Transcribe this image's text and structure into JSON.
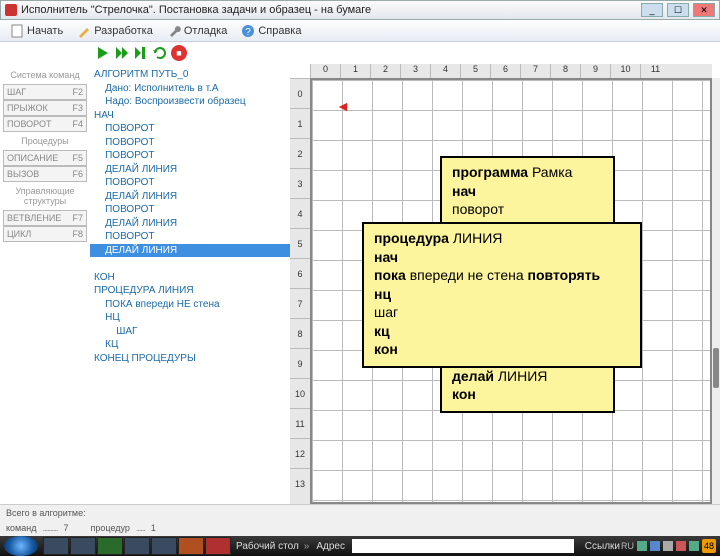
{
  "window": {
    "title": "Исполнитель \"Стрелочка\". Постановка задачи и образец - на бумаге"
  },
  "menu": {
    "start": "Начать",
    "dev": "Разработка",
    "debug": "Отладка",
    "help": "Справка"
  },
  "sidebar": {
    "hdr1": "Система команд",
    "items1": [
      {
        "label": "ШАГ",
        "key": "F2"
      },
      {
        "label": "ПРЫЖОК",
        "key": "F3"
      },
      {
        "label": "ПОВОРОТ",
        "key": "F4"
      }
    ],
    "hdr2": "Процедуры",
    "items2": [
      {
        "label": "ОПИСАНИЕ",
        "key": "F5"
      },
      {
        "label": "ВЫЗОВ",
        "key": "F6"
      }
    ],
    "hdr3": "Управляющие структуры",
    "items3": [
      {
        "label": "ВЕТВЛЕНИЕ",
        "key": "F7"
      },
      {
        "label": "ЦИКЛ",
        "key": "F8"
      }
    ]
  },
  "code": {
    "lines": [
      "АЛГОРИТМ ПУТЬ_0",
      "    Дано: Исполнитель в т.А",
      "    Надо: Воспроизвести образец",
      "НАЧ",
      "    ПОВОРОТ",
      "    ПОВОРОТ",
      "    ПОВОРОТ",
      "    ДЕЛАЙ ЛИНИЯ",
      "    ПОВОРОТ",
      "    ДЕЛАЙ ЛИНИЯ",
      "    ПОВОРОТ",
      "    ДЕЛАЙ ЛИНИЯ",
      "    ПОВОРОТ",
      "    ДЕЛАЙ ЛИНИЯ",
      "КОН",
      "ПРОЦЕДУРА ЛИНИЯ",
      "    ПОКА впереди НЕ стена",
      "    НЦ",
      "        ШАГ",
      "    КЦ",
      "КОНЕЦ ПРОЦЕДУРЫ"
    ],
    "selected_index": 13
  },
  "ruler_h": [
    "0",
    "1",
    "2",
    "3",
    "4",
    "5",
    "6",
    "7",
    "8",
    "9",
    "10",
    "11"
  ],
  "ruler_v": [
    "0",
    "1",
    "2",
    "3",
    "4",
    "5",
    "6",
    "7",
    "8",
    "9",
    "10",
    "11",
    "12",
    "13"
  ],
  "box1_lines": [
    {
      "t": "программа ",
      "b": true
    },
    {
      "t": "Рамка",
      "b": false,
      "br": true
    },
    {
      "t": "нач",
      "b": true,
      "br": true
    },
    {
      "t": " поворот",
      "b": false,
      "br": true
    },
    {
      "t": " поворот",
      "b": false,
      "br": true
    },
    {
      "t": " поворот",
      "b": false,
      "br": true
    },
    {
      "t": " делай ",
      "b": true
    },
    {
      "t": "ЛИНИЯ",
      "b": false,
      "br": true
    },
    {
      "t": " поворот",
      "b": false,
      "br": true
    },
    {
      "t": " делай ",
      "b": true
    },
    {
      "t": "ЛИНИЯ",
      "b": false,
      "br": true
    },
    {
      "t": " поворот",
      "b": false,
      "br": true
    },
    {
      "t": " делай ",
      "b": true
    },
    {
      "t": "ЛИНИЯ",
      "b": false,
      "br": true
    },
    {
      "t": " поворот",
      "b": false,
      "hl": true,
      "br": true
    },
    {
      "t": " делай ",
      "b": true
    },
    {
      "t": "ЛИНИЯ",
      "b": false,
      "br": true
    },
    {
      "t": "кон",
      "b": true,
      "br": true
    }
  ],
  "box2_lines": [
    {
      "t": "процедура ",
      "b": true
    },
    {
      "t": "ЛИНИЯ",
      "b": false,
      "br": true
    },
    {
      "t": "нач",
      "b": true,
      "br": true
    },
    {
      "t": "  пока ",
      "b": true
    },
    {
      "t": "впереди не стена ",
      "b": false
    },
    {
      "t": "повторять",
      "b": true,
      "br": true
    },
    {
      "t": "   нц",
      "b": true,
      "br": true
    },
    {
      "t": "     шаг",
      "b": false,
      "br": true
    },
    {
      "t": "   кц",
      "b": true,
      "br": true
    },
    {
      "t": "кон",
      "b": true,
      "br": true
    }
  ],
  "status": {
    "label1": "Всего в алгоритме:",
    "label2": "команд",
    "val2": "7",
    "label3": "процедур",
    "val3": "1"
  },
  "taskbar": {
    "desktop": "Рабочий стол",
    "addr_label": "Адрес",
    "links": "Ссылки",
    "lang": "RU",
    "badge": "48"
  }
}
